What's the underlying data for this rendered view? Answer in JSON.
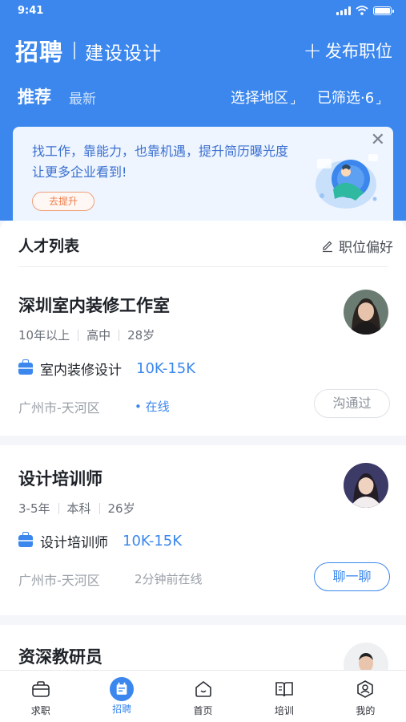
{
  "status_bar": {
    "time": "9:41"
  },
  "header": {
    "title": "招聘",
    "category": "建设设计",
    "post_job_label": "发布职位",
    "tabs": {
      "recommended": "推荐",
      "latest": "最新"
    },
    "filters": {
      "region": "选择地区",
      "selected": "已筛选·6"
    }
  },
  "banner": {
    "text": "找工作，靠能力，也靠机遇，提升简历曝光度让更多企业看到!",
    "button_label": "去提升"
  },
  "list": {
    "title": "人才列表",
    "preference_label": "职位偏好",
    "cards": [
      {
        "name": "深圳室内装修工作室",
        "experience": "10年以上",
        "education": "高中",
        "age": "28岁",
        "job": "室内装修设计",
        "salary": "10K-15K",
        "location": "广州市-天河区",
        "status": "• 在线",
        "action": "沟通过"
      },
      {
        "name": "设计培训师",
        "experience": "3-5年",
        "education": "本科",
        "age": "26岁",
        "job": "设计培训师",
        "salary": "10K-15K",
        "location": "广州市-天河区",
        "status": "2分钟前在线",
        "action": "聊一聊"
      },
      {
        "name": "资深教研员"
      }
    ]
  },
  "tabbar": [
    {
      "label": "求职",
      "icon": "briefcase-icon"
    },
    {
      "label": "招聘",
      "icon": "recruit-icon",
      "active": true
    },
    {
      "label": "首页",
      "icon": "home-icon"
    },
    {
      "label": "培训",
      "icon": "book-icon"
    },
    {
      "label": "我的",
      "icon": "profile-icon"
    }
  ],
  "colors": {
    "primary": "#3b87ee",
    "online": "#3b87ee",
    "banner_button": "#ef7c4a"
  }
}
